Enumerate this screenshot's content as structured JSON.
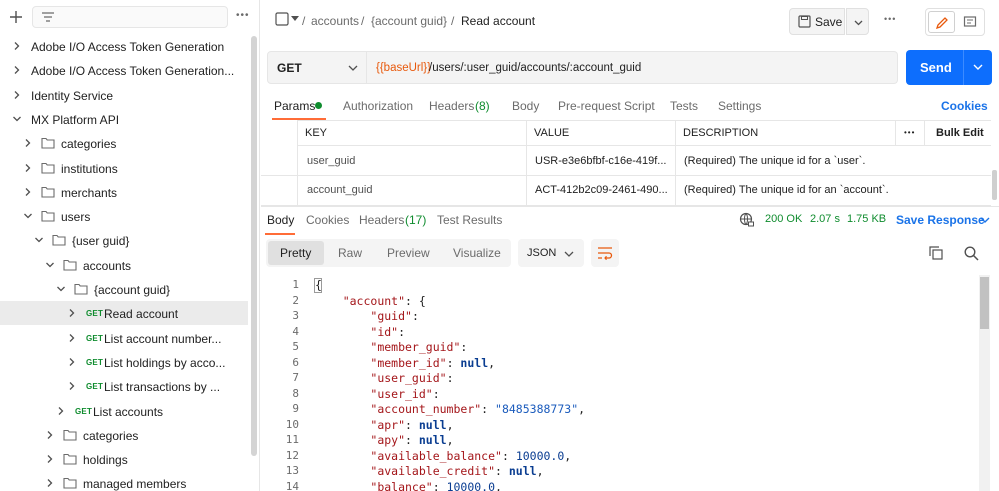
{
  "sidebar": {
    "tree": [
      {
        "label": "Adobe I/O Access Token Generation",
        "type": "collection",
        "method": ""
      },
      {
        "label": "Adobe I/O Access Token Generation...",
        "type": "collection",
        "method": ""
      },
      {
        "label": "Identity Service",
        "type": "collection",
        "method": ""
      },
      {
        "label": "MX Platform API",
        "type": "collection",
        "method": ""
      },
      {
        "label": "categories",
        "type": "folder",
        "method": ""
      },
      {
        "label": "institutions",
        "type": "folder",
        "method": ""
      },
      {
        "label": "merchants",
        "type": "folder",
        "method": ""
      },
      {
        "label": "users",
        "type": "folder",
        "method": ""
      },
      {
        "label": "{user guid}",
        "type": "folder",
        "method": ""
      },
      {
        "label": "accounts",
        "type": "folder",
        "method": ""
      },
      {
        "label": "{account guid}",
        "type": "folder",
        "method": ""
      },
      {
        "label": "Read account",
        "type": "request",
        "method": "GET"
      },
      {
        "label": "List account number...",
        "type": "request",
        "method": "GET"
      },
      {
        "label": "List holdings by acco...",
        "type": "request",
        "method": "GET"
      },
      {
        "label": "List transactions by ...",
        "type": "request",
        "method": "GET"
      },
      {
        "label": "List accounts",
        "type": "request",
        "method": "GET"
      },
      {
        "label": "categories",
        "type": "folder",
        "method": ""
      },
      {
        "label": "holdings",
        "type": "folder",
        "method": ""
      },
      {
        "label": "managed members",
        "type": "folder",
        "method": ""
      }
    ]
  },
  "header": {
    "crumb_1": "accounts",
    "crumb_2": "{account guid}",
    "title": "Read account",
    "sep": "/",
    "save_label": "Save",
    "more": "•••"
  },
  "request": {
    "method": "GET",
    "url_var": "{{baseUrl}}",
    "url_rest": "/users/:user_guid/accounts/:account_guid",
    "send_label": "Send"
  },
  "req_tabs": {
    "params": "Params",
    "authorization": "Authorization",
    "headers": "Headers",
    "headers_count": "(8)",
    "body": "Body",
    "prerequest": "Pre-request Script",
    "tests": "Tests",
    "settings": "Settings",
    "cookies": "Cookies"
  },
  "params_table": {
    "key": "KEY",
    "value": "VALUE",
    "description": "DESCRIPTION",
    "bulk_edit": "Bulk Edit",
    "more": "•••",
    "rows": [
      {
        "key": "user_guid",
        "value": "USR-e3e6bfbf-c16e-419f...",
        "description": "(Required) The unique id for a `user`."
      },
      {
        "key": "account_guid",
        "value": "ACT-412b2c09-2461-490...",
        "description": "(Required) The unique id for an `account`."
      }
    ]
  },
  "resp_tabs": {
    "body": "Body",
    "cookies": "Cookies",
    "headers": "Headers",
    "headers_count": "(17)",
    "test_results": "Test Results",
    "status": "200 OK",
    "time": "2.07 s",
    "size": "1.75 KB",
    "save_response": "Save Response"
  },
  "view_modes": {
    "pretty": "Pretty",
    "raw": "Raw",
    "preview": "Preview",
    "visualize": "Visualize",
    "format": "JSON"
  },
  "code": [
    {
      "ln": "1",
      "parts": [
        {
          "t": "{",
          "c": "p"
        }
      ]
    },
    {
      "ln": "2",
      "parts": [
        {
          "t": "    ",
          "c": "p"
        },
        {
          "t": "\"account\"",
          "c": "k"
        },
        {
          "t": ": {",
          "c": "p"
        }
      ]
    },
    {
      "ln": "3",
      "parts": [
        {
          "t": "        ",
          "c": "p"
        },
        {
          "t": "\"guid\"",
          "c": "k"
        },
        {
          "t": ":",
          "c": "p"
        }
      ]
    },
    {
      "ln": "4",
      "parts": [
        {
          "t": "        ",
          "c": "p"
        },
        {
          "t": "\"id\"",
          "c": "k"
        },
        {
          "t": ":",
          "c": "p"
        }
      ]
    },
    {
      "ln": "5",
      "parts": [
        {
          "t": "        ",
          "c": "p"
        },
        {
          "t": "\"member_guid\"",
          "c": "k"
        },
        {
          "t": ":",
          "c": "p"
        }
      ]
    },
    {
      "ln": "6",
      "parts": [
        {
          "t": "        ",
          "c": "p"
        },
        {
          "t": "\"member_id\"",
          "c": "k"
        },
        {
          "t": ": ",
          "c": "p"
        },
        {
          "t": "null",
          "c": "n"
        },
        {
          "t": ",",
          "c": "p"
        }
      ]
    },
    {
      "ln": "7",
      "parts": [
        {
          "t": "        ",
          "c": "p"
        },
        {
          "t": "\"user_guid\"",
          "c": "k"
        },
        {
          "t": ":",
          "c": "p"
        }
      ]
    },
    {
      "ln": "8",
      "parts": [
        {
          "t": "        ",
          "c": "p"
        },
        {
          "t": "\"user_id\"",
          "c": "k"
        },
        {
          "t": ":",
          "c": "p"
        }
      ]
    },
    {
      "ln": "9",
      "parts": [
        {
          "t": "        ",
          "c": "p"
        },
        {
          "t": "\"account_number\"",
          "c": "k"
        },
        {
          "t": ": ",
          "c": "p"
        },
        {
          "t": "\"8485388773\"",
          "c": "s"
        },
        {
          "t": ",",
          "c": "p"
        }
      ]
    },
    {
      "ln": "10",
      "parts": [
        {
          "t": "        ",
          "c": "p"
        },
        {
          "t": "\"apr\"",
          "c": "k"
        },
        {
          "t": ": ",
          "c": "p"
        },
        {
          "t": "null",
          "c": "n"
        },
        {
          "t": ",",
          "c": "p"
        }
      ]
    },
    {
      "ln": "11",
      "parts": [
        {
          "t": "        ",
          "c": "p"
        },
        {
          "t": "\"apy\"",
          "c": "k"
        },
        {
          "t": ": ",
          "c": "p"
        },
        {
          "t": "null",
          "c": "n"
        },
        {
          "t": ",",
          "c": "p"
        }
      ]
    },
    {
      "ln": "12",
      "parts": [
        {
          "t": "        ",
          "c": "p"
        },
        {
          "t": "\"available_balance\"",
          "c": "k"
        },
        {
          "t": ": ",
          "c": "p"
        },
        {
          "t": "10000.0",
          "c": "num"
        },
        {
          "t": ",",
          "c": "p"
        }
      ]
    },
    {
      "ln": "13",
      "parts": [
        {
          "t": "        ",
          "c": "p"
        },
        {
          "t": "\"available_credit\"",
          "c": "k"
        },
        {
          "t": ": ",
          "c": "p"
        },
        {
          "t": "null",
          "c": "n"
        },
        {
          "t": ",",
          "c": "p"
        }
      ]
    },
    {
      "ln": "14",
      "parts": [
        {
          "t": "        ",
          "c": "p"
        },
        {
          "t": "\"balance\"",
          "c": "k"
        },
        {
          "t": ": ",
          "c": "p"
        },
        {
          "t": "10000.0",
          "c": "num"
        },
        {
          "t": ",",
          "c": "p"
        }
      ]
    }
  ],
  "colors": {
    "accent": "#1a73e8",
    "method_get": "#0f8c2e",
    "send": "#0d6efd",
    "tab_underline": "#ff6c37"
  }
}
